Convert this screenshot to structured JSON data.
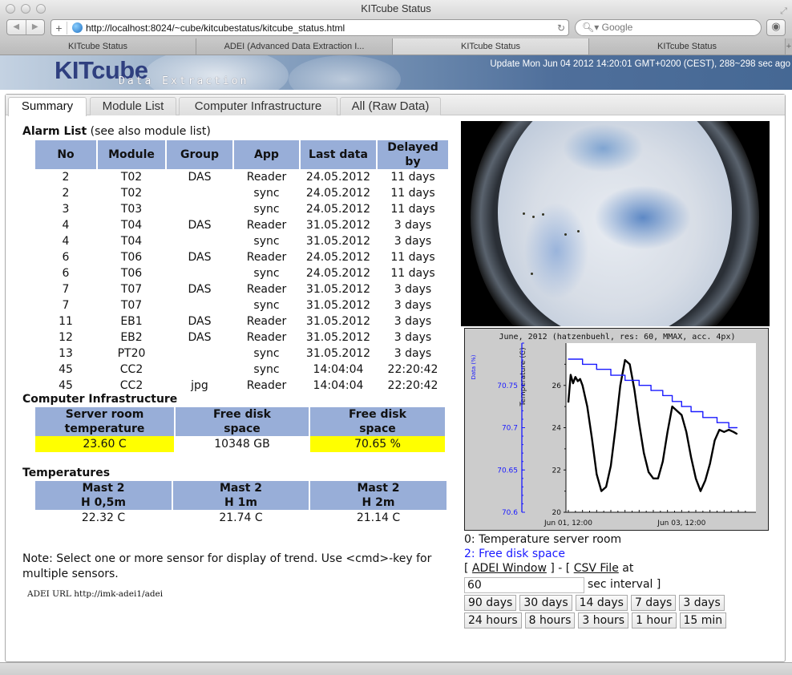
{
  "browser": {
    "window_title": "KITcube Status",
    "url": "http://localhost:8024/~cube/kitcubestatus/kitcube_status.html",
    "search_placeholder": "Google",
    "tabs": [
      {
        "label": "KITcube Status",
        "active": false
      },
      {
        "label": "ADEI (Advanced Data Extraction I...",
        "active": false
      },
      {
        "label": "KITcube Status",
        "active": true
      },
      {
        "label": "KITcube Status",
        "active": false
      }
    ]
  },
  "banner": {
    "logo": "KITcube",
    "logo_sub": "Data Extraction",
    "update_text": "Update Mon Jun 04 2012 14:20:01 GMT+0200 (CEST), 288~298 sec ago"
  },
  "page_tabs": [
    {
      "label": "Summary",
      "active": true
    },
    {
      "label": "Module List",
      "active": false
    },
    {
      "label": "Computer Infrastructure",
      "active": false
    },
    {
      "label": "All (Raw Data)",
      "active": false
    }
  ],
  "alarm_list": {
    "title": "Alarm List",
    "note": " (see also module list)",
    "columns": [
      "No",
      "Module",
      "Group",
      "App",
      "Last data",
      "Delayed by"
    ],
    "rows": [
      [
        "2",
        "T02",
        "DAS",
        "Reader",
        "24.05.2012",
        "11 days"
      ],
      [
        "2",
        "T02",
        "",
        "sync",
        "24.05.2012",
        "11 days"
      ],
      [
        "3",
        "T03",
        "",
        "sync",
        "24.05.2012",
        "11 days"
      ],
      [
        "4",
        "T04",
        "DAS",
        "Reader",
        "31.05.2012",
        "3 days"
      ],
      [
        "4",
        "T04",
        "",
        "sync",
        "31.05.2012",
        "3 days"
      ],
      [
        "6",
        "T06",
        "DAS",
        "Reader",
        "24.05.2012",
        "11 days"
      ],
      [
        "6",
        "T06",
        "",
        "sync",
        "24.05.2012",
        "11 days"
      ],
      [
        "7",
        "T07",
        "DAS",
        "Reader",
        "31.05.2012",
        "3 days"
      ],
      [
        "7",
        "T07",
        "",
        "sync",
        "31.05.2012",
        "3 days"
      ],
      [
        "11",
        "EB1",
        "DAS",
        "Reader",
        "31.05.2012",
        "3 days"
      ],
      [
        "12",
        "EB2",
        "DAS",
        "Reader",
        "31.05.2012",
        "3 days"
      ],
      [
        "13",
        "PT20",
        "",
        "sync",
        "31.05.2012",
        "3 days"
      ],
      [
        "45",
        "CC2",
        "",
        "sync",
        "14:04:04",
        "22:20:42"
      ],
      [
        "45",
        "CC2",
        "jpg",
        "Reader",
        "14:04:04",
        "22:20:42"
      ]
    ]
  },
  "infrastructure": {
    "title": "Computer Infrastructure",
    "headers": [
      {
        "line1": "Server room",
        "line2": "temperature"
      },
      {
        "line1": "Free disk",
        "line2": "space"
      },
      {
        "line1": "Free disk",
        "line2": "space"
      }
    ],
    "values": [
      {
        "text": "23.60 C",
        "highlight": true
      },
      {
        "text": "10348 GB",
        "highlight": false
      },
      {
        "text": "70.65 %",
        "highlight": true
      }
    ],
    "highlight_color": "#ffff00"
  },
  "temperatures": {
    "title": "Temperatures",
    "headers": [
      {
        "line1": "Mast 2",
        "line2": "H 0,5m"
      },
      {
        "line1": "Mast 2",
        "line2": "H 1m"
      },
      {
        "line1": "Mast 2",
        "line2": "H 2m"
      }
    ],
    "values": [
      "22.32 C",
      "21.74 C",
      "21.14 C"
    ]
  },
  "note": "Note: Select one or more sensor for display of trend. Use <cmd>-key for multiple sensors.",
  "adei_url": "ADEI URL http://imk-adei1/adei",
  "sky_image": {
    "alt": "all-sky fisheye camera image"
  },
  "chart_data": {
    "type": "line",
    "title": "June, 2012 (hatzenbuehl, res: 60, MMAX, acc. 4px)",
    "x_tick_labels": [
      "Jun 01, 12:00",
      "Jun 03, 12:00"
    ],
    "xlim_hours": [
      0,
      72
    ],
    "x_label_positions_hours": [
      0,
      48
    ],
    "y_left_outer": {
      "label": "Data (%)",
      "color": "#1a1aff",
      "ticks": [
        "70.75",
        "70.7",
        "70.65",
        "70.6"
      ],
      "ylim": [
        70.6,
        70.8
      ]
    },
    "y_left_inner": {
      "label": "Temperature (C)",
      "color": "#000000",
      "ticks": [
        "26",
        "24",
        "22",
        "20"
      ],
      "ylim": [
        20,
        28
      ]
    },
    "series": [
      {
        "name": "Temperature server room",
        "axis": "inner",
        "color": "#000000",
        "x_hours": [
          0,
          1,
          2,
          3,
          4,
          5,
          6,
          8,
          10,
          12,
          14,
          16,
          18,
          20,
          22,
          24,
          26,
          28,
          30,
          32,
          34,
          36,
          38,
          40,
          42,
          44,
          46,
          48,
          50,
          52,
          54,
          56,
          58,
          60,
          62,
          64,
          66,
          68,
          70,
          71.5
        ],
        "values": [
          25.2,
          26.5,
          26.1,
          26.4,
          26.2,
          26.3,
          26.0,
          25.0,
          23.5,
          21.8,
          21.0,
          21.2,
          22.2,
          24.0,
          26.0,
          27.2,
          27.0,
          25.8,
          24.2,
          22.8,
          21.9,
          21.6,
          21.6,
          22.4,
          23.8,
          25.0,
          24.8,
          24.6,
          23.8,
          22.6,
          21.6,
          21.0,
          21.5,
          22.3,
          23.4,
          23.9,
          23.8,
          23.9,
          23.8,
          23.7
        ],
        "note": "approximate reading"
      },
      {
        "name": "Free disk space",
        "axis": "outer",
        "color": "#1a1aff",
        "step": true,
        "x_hours": [
          0,
          6,
          12,
          18,
          24,
          30,
          35,
          40,
          44,
          48,
          52,
          57,
          63,
          68,
          71.5
        ],
        "values": [
          70.781,
          70.775,
          70.769,
          70.762,
          70.756,
          70.75,
          70.744,
          70.738,
          70.731,
          70.725,
          70.719,
          70.712,
          70.706,
          70.7,
          70.7
        ],
        "note": "approximate step levels"
      }
    ]
  },
  "chart_legend": [
    {
      "label": "0: Temperature server room",
      "color": "#111111"
    },
    {
      "label": "2: Free disk space",
      "color": "#1a1aff"
    }
  ],
  "export": {
    "bracket_open": "[ ",
    "adei_window": "ADEI Window",
    "separator": " ] - [ ",
    "csv_file": "CSV File",
    "at": " at",
    "interval_value": "60",
    "interval_label": "sec interval ]"
  },
  "range_buttons_row1": [
    "90 days",
    "30 days",
    "14 days",
    "7 days",
    "3 days"
  ],
  "range_buttons_row2": [
    "24 hours",
    "8 hours",
    "3 hours",
    "1 hour",
    "15 min"
  ]
}
